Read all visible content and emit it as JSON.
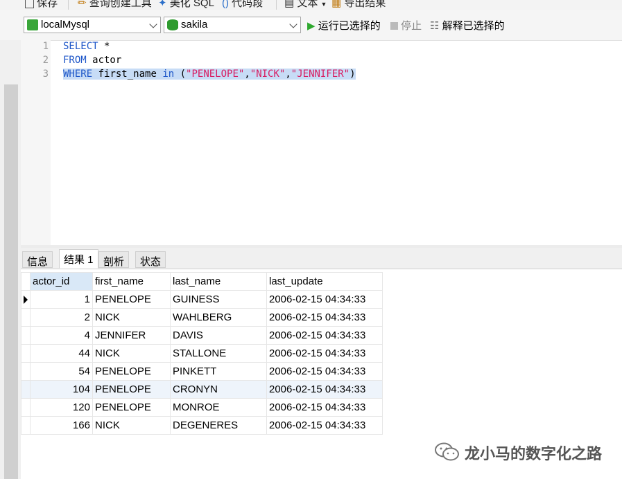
{
  "top_toolbar": {
    "save": "保存",
    "query_builder": "查询创建工具",
    "beautify_sql": "美化 SQL",
    "snippet": "代码段",
    "text": "文本",
    "export": "导出结果"
  },
  "connection": {
    "value": "localMysql",
    "icon_color": "#3aa63a"
  },
  "database": {
    "value": "sakila",
    "icon_color": "#2e9b2e"
  },
  "actions": {
    "run_selected": "运行已选择的",
    "stop": "停止",
    "explain_selected": "解释已选择的"
  },
  "editor": {
    "lines": [
      "1",
      "2",
      "3"
    ],
    "line1": {
      "kw": "SELECT",
      "rest": " *"
    },
    "line2": {
      "kw": "FROM",
      "rest": " actor"
    },
    "line3": {
      "kw1": "WHERE",
      "mid": " first_name ",
      "kw2": "in",
      "p1": " (",
      "s1": "\"PENELOPE\"",
      "c1": ",",
      "s2": "\"NICK\"",
      "c2": ",",
      "s3": "\"JENNIFER\"",
      "p2": ")"
    }
  },
  "tabs": [
    "信息",
    "结果 1",
    "剖析",
    "状态"
  ],
  "results": {
    "columns": [
      "actor_id",
      "first_name",
      "last_name",
      "last_update"
    ],
    "rows": [
      [
        "1",
        "PENELOPE",
        "GUINESS",
        "2006-02-15 04:34:33"
      ],
      [
        "2",
        "NICK",
        "WAHLBERG",
        "2006-02-15 04:34:33"
      ],
      [
        "4",
        "JENNIFER",
        "DAVIS",
        "2006-02-15 04:34:33"
      ],
      [
        "44",
        "NICK",
        "STALLONE",
        "2006-02-15 04:34:33"
      ],
      [
        "54",
        "PENELOPE",
        "PINKETT",
        "2006-02-15 04:34:33"
      ],
      [
        "104",
        "PENELOPE",
        "CRONYN",
        "2006-02-15 04:34:33"
      ],
      [
        "120",
        "PENELOPE",
        "MONROE",
        "2006-02-15 04:34:33"
      ],
      [
        "166",
        "NICK",
        "DEGENERES",
        "2006-02-15 04:34:33"
      ]
    ]
  },
  "watermark": {
    "text": "龙小马的数字化之路"
  }
}
